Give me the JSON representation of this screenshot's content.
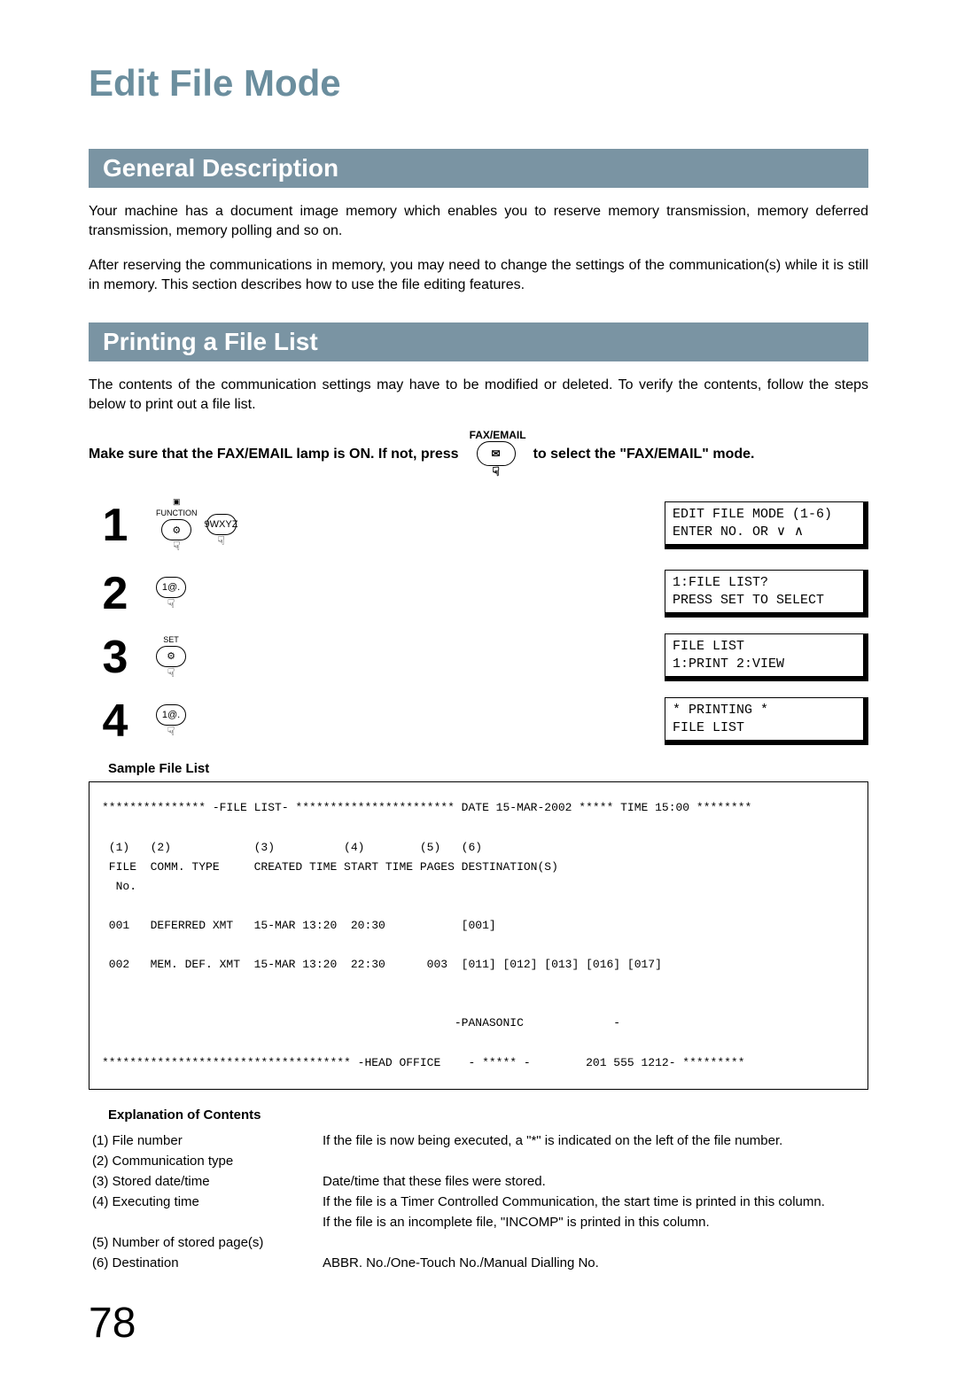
{
  "page_title": "Edit File Mode",
  "section1": {
    "header": "General Description",
    "p1": "Your machine has a document image memory which enables you to reserve memory transmission, memory deferred transmission, memory polling and so on.",
    "p2": "After reserving the communications in memory, you may need to change the settings of the communication(s) while it is still in memory.  This section describes how to use the file editing features."
  },
  "section2": {
    "header": "Printing a File List",
    "p1": "The contents of the communication settings may have to be modified or deleted.  To verify the contents, follow the steps below to print out a file list.",
    "intro_a": "Make sure that the FAX/EMAIL lamp is ON.  If not, press",
    "intro_b": "to select the \"FAX/EMAIL\" mode.",
    "fax_label": "FAX/EMAIL"
  },
  "keys": {
    "function": "FUNCTION",
    "set": "SET",
    "nine": "9WXYZ",
    "one": "1@."
  },
  "lcd": {
    "s1l1": "EDIT FILE MODE (1-6)",
    "s1l2": "ENTER NO. OR ∨ ∧",
    "s2l1": "1:FILE LIST?",
    "s2l2": "PRESS SET TO SELECT",
    "s3l1": "FILE LIST",
    "s3l2": "1:PRINT 2:VIEW",
    "s4l1": "* PRINTING *",
    "s4l2": "FILE LIST"
  },
  "steps": {
    "n1": "1",
    "n2": "2",
    "n3": "3",
    "n4": "4"
  },
  "sample": {
    "title": "Sample File List",
    "l1": "*************** -FILE LIST- *********************** DATE 15-MAR-2002 ***** TIME 15:00 ********",
    "l2": " (1)   (2)            (3)          (4)        (5)   (6)",
    "l3": " FILE  COMM. TYPE     CREATED TIME START TIME PAGES DESTINATION(S)",
    "l4": "  No.",
    "l5": " 001   DEFERRED XMT   15-MAR 13:20  20:30           [001]",
    "l6": " 002   MEM. DEF. XMT  15-MAR 13:20  22:30      003  [011] [012] [013] [016] [017]",
    "l7": "                                                   -PANASONIC             -",
    "l8": "************************************ -HEAD OFFICE    - ***** -        201 555 1212- *********"
  },
  "explanation": {
    "title": "Explanation of Contents",
    "rows": [
      {
        "label": "(1) File number",
        "desc": "If the file is now being executed, a \"*\" is indicated on the left of the file number."
      },
      {
        "label": "(2) Communication type",
        "desc": ""
      },
      {
        "label": "(3) Stored date/time",
        "desc": "Date/time that these files were stored."
      },
      {
        "label": "(4) Executing time",
        "desc": "If the file is a Timer Controlled Communication, the start time is printed in this column."
      },
      {
        "label": "",
        "desc": "If the file is an incomplete file, \"INCOMP\" is printed in this column."
      },
      {
        "label": "(5) Number of stored page(s)",
        "desc": ""
      },
      {
        "label": "(6) Destination",
        "desc": "ABBR. No./One-Touch No./Manual Dialling No."
      }
    ]
  },
  "page_number": "78"
}
